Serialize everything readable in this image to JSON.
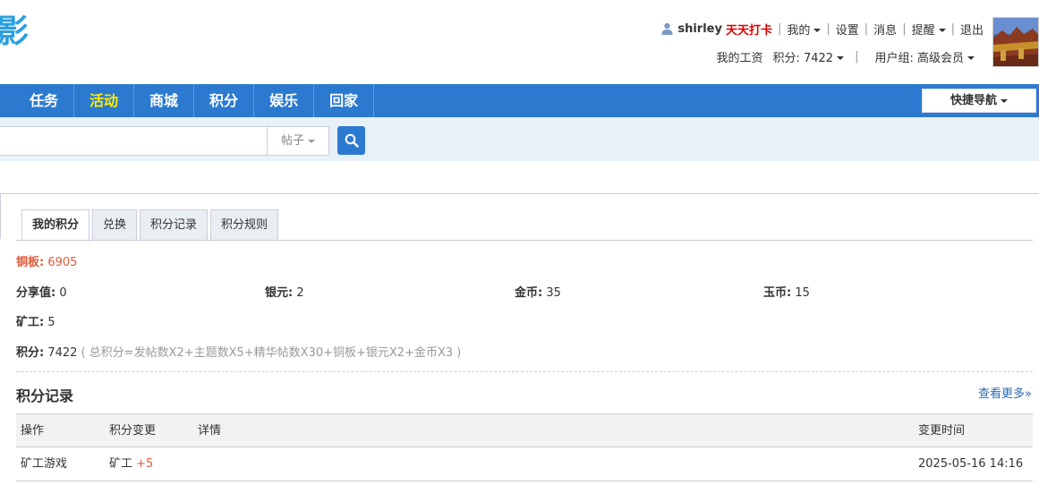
{
  "site": {
    "logo_text": "影"
  },
  "header": {
    "username": "shirley",
    "checkin": "天天打卡",
    "menu": [
      "我的",
      "设置",
      "消息",
      "提醒",
      "退出"
    ],
    "salary": "我的工资",
    "points_label": "积分: 7422",
    "usergroup_label": "用户组: 高级会员"
  },
  "nav": {
    "items": [
      "任务",
      "活动",
      "商城",
      "积分",
      "娱乐",
      "回家"
    ],
    "active": "活动",
    "quick_nav": "快捷导航"
  },
  "search": {
    "value": "",
    "type": "帖子"
  },
  "tabs": [
    "我的积分",
    "兑换",
    "积分记录",
    "积分规则"
  ],
  "credits": {
    "copper_label": "铜板:",
    "copper_value": "6905",
    "share_label": "分享值:",
    "share_value": "0",
    "silver_label": "银元:",
    "silver_value": "2",
    "gold_label": "金币:",
    "gold_value": "35",
    "jade_label": "玉币:",
    "jade_value": "15",
    "miner_label": "矿工:",
    "miner_value": "5",
    "total_label": "积分:",
    "total_value": "7422",
    "formula": "( 总积分=发帖数X2+主题数X5+精华帖数X30+铜板+银元X2+金币X3 )"
  },
  "records": {
    "title": "积分记录",
    "more": "查看更多»",
    "columns": [
      "操作",
      "积分变更",
      "详情",
      "变更时间"
    ],
    "rows": [
      {
        "action": "矿工游戏",
        "change_name": "矿工",
        "change_value": "+5",
        "detail": "",
        "time": "2025-05-16 14:16"
      }
    ]
  },
  "colors": {
    "nav_bg": "#2b7ad0",
    "active_nav": "#ffea00",
    "accent_red": "#e05a3a",
    "link": "#2b6bb0"
  }
}
